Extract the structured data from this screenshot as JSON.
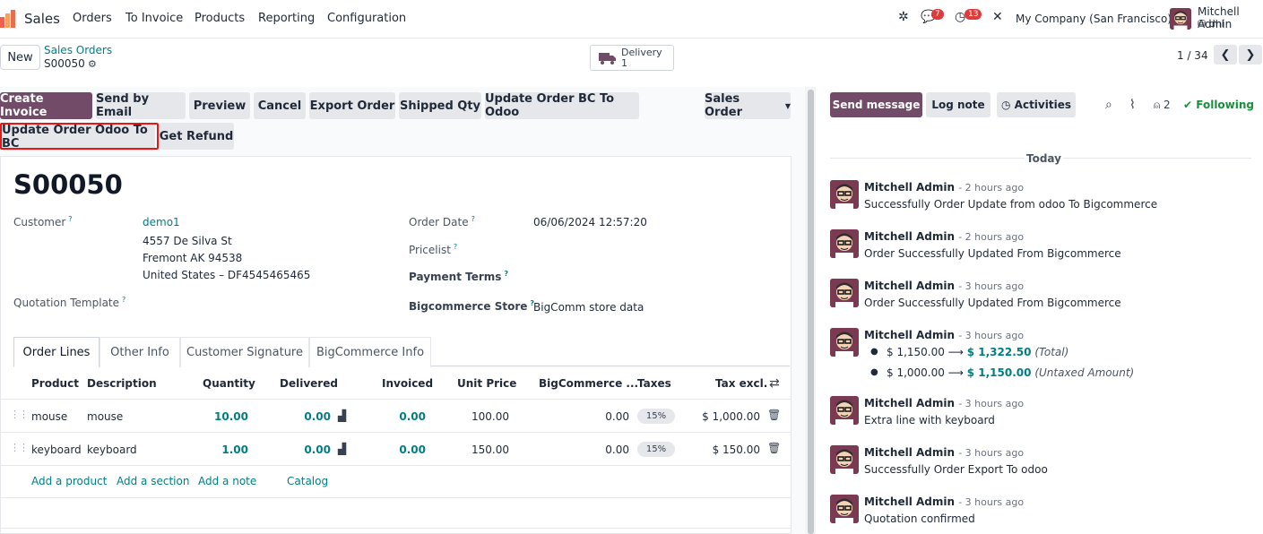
{
  "nav": {
    "app_name": "Sales",
    "menu": [
      "Orders",
      "To Invoice",
      "Products",
      "Reporting",
      "Configuration"
    ],
    "messages_count": "7",
    "activities_count": "13",
    "company": "My Company (San Francisco)",
    "user_name": "Mitchell Admin",
    "user_db": "dhl"
  },
  "control_panel": {
    "new_label": "New",
    "breadcrumb_parent": "Sales Orders",
    "breadcrumb_current": "S00050",
    "smart_button": {
      "label": "Delivery",
      "count": "1"
    },
    "pager": "1 / 34"
  },
  "statusbar": {
    "row1": [
      "Create Invoice",
      "Send by Email",
      "Preview",
      "Cancel",
      "Export Order",
      "Shipped Qty",
      "Update Order BC To Odoo"
    ],
    "row2": [
      "Update Order Odoo To BC",
      "Get Refund"
    ],
    "dropdown_label": "Sales Order"
  },
  "form": {
    "title": "S00050",
    "customer_label": "Customer",
    "customer_name": "demo1",
    "customer_address": [
      "4557 De Silva St",
      "Fremont AK 94538",
      "United States – DF4545465465"
    ],
    "quotation_template_label": "Quotation Template",
    "order_date_label": "Order Date",
    "order_date": "06/06/2024 12:57:20",
    "pricelist_label": "Pricelist",
    "payment_terms_label": "Payment Terms",
    "bigcommerce_store_label": "Bigcommerce Store",
    "bigcommerce_store": "BigComm store data",
    "help_mark": "?"
  },
  "tabs": [
    "Order Lines",
    "Other Info",
    "Customer Signature",
    "BigCommerce Info"
  ],
  "order_lines": {
    "headers": [
      "Product",
      "Description",
      "Quantity",
      "Delivered",
      "Invoiced",
      "Unit Price",
      "BigCommerce ...",
      "Taxes",
      "Tax excl."
    ],
    "rows": [
      {
        "product": "mouse",
        "description": "mouse",
        "quantity": "10.00",
        "delivered": "0.00",
        "invoiced": "0.00",
        "unit_price": "100.00",
        "bigcommerce": "0.00",
        "taxes": "15%",
        "tax_excl": "$ 1,000.00"
      },
      {
        "product": "keyboard",
        "description": "keyboard",
        "quantity": "1.00",
        "delivered": "0.00",
        "invoiced": "0.00",
        "unit_price": "150.00",
        "bigcommerce": "0.00",
        "taxes": "15%",
        "tax_excl": "$ 150.00"
      }
    ],
    "add_links": [
      "Add a product",
      "Add a section",
      "Add a note",
      "Catalog"
    ]
  },
  "chatter": {
    "send_message": "Send message",
    "log_note": "Log note",
    "activities": "Activities",
    "followers_count": "2",
    "following": "Following",
    "today": "Today",
    "messages": [
      {
        "author": "Mitchell Admin",
        "when": "- 2 hours ago",
        "body": "Successfully Order Update from odoo To Bigcommerce"
      },
      {
        "author": "Mitchell Admin",
        "when": "- 2 hours ago",
        "body": "Order Successfully Updated From Bigcommerce"
      },
      {
        "author": "Mitchell Admin",
        "when": "- 3 hours ago",
        "body": "Order Successfully Updated From Bigcommerce"
      },
      {
        "author": "Mitchell Admin",
        "when": "- 3 hours ago",
        "tracking": [
          {
            "old": "$ 1,150.00",
            "new": "$ 1,322.50",
            "field": "(Total)"
          },
          {
            "old": "$ 1,000.00",
            "new": "$ 1,150.00",
            "field": "(Untaxed Amount)"
          }
        ]
      },
      {
        "author": "Mitchell Admin",
        "when": "- 3 hours ago",
        "body": "Extra line with keyboard"
      },
      {
        "author": "Mitchell Admin",
        "when": "- 3 hours ago",
        "body": "Successfully Order Export To odoo"
      },
      {
        "author": "Mitchell Admin",
        "when": "- 3 hours ago",
        "body": "Quotation confirmed"
      }
    ]
  },
  "colors": {
    "brand": "#714b67",
    "teal": "#017e84",
    "highlight": "#e81717",
    "badge": "#e03b3b"
  }
}
